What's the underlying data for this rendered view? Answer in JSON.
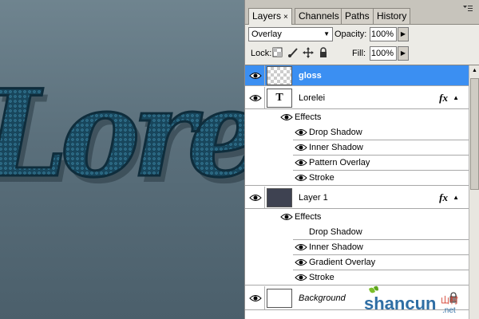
{
  "canvas": {
    "art_text": "Lorelei"
  },
  "tabs": [
    {
      "label": "Layers",
      "close": "×"
    },
    {
      "label": "Channels"
    },
    {
      "label": "Paths"
    },
    {
      "label": "History"
    }
  ],
  "toolbar": {
    "blend_mode": "Overlay",
    "opacity_label": "Opacity:",
    "opacity_value": "100%",
    "lock_label": "Lock:",
    "fill_label": "Fill:",
    "fill_value": "100%"
  },
  "layers": [
    {
      "name": "gloss",
      "thumbnail": "checkerboard",
      "selected": true
    },
    {
      "name": "Lorelei",
      "thumbnail": "text-T",
      "fx": "fx",
      "effects_label": "Effects",
      "effects": [
        "Drop Shadow",
        "Inner Shadow",
        "Pattern Overlay",
        "Stroke"
      ]
    },
    {
      "name": "Layer 1",
      "thumbnail": "dark-fill",
      "fx": "fx",
      "effects_label": "Effects",
      "effects": [
        "Drop Shadow",
        "Inner Shadow",
        "Gradient Overlay",
        "Stroke"
      ]
    },
    {
      "name": "Background",
      "thumbnail": "white",
      "locked": true
    }
  ],
  "thumb_text_glyph": "T",
  "watermark": {
    "brand": "shancun",
    "suffix": ".net",
    "cn": "山村"
  },
  "colors": {
    "selection": "#3b8ff2",
    "canvas_top": "#6f848f",
    "canvas_bottom": "#4b5f6b",
    "text_fill": "#1f4d63"
  }
}
